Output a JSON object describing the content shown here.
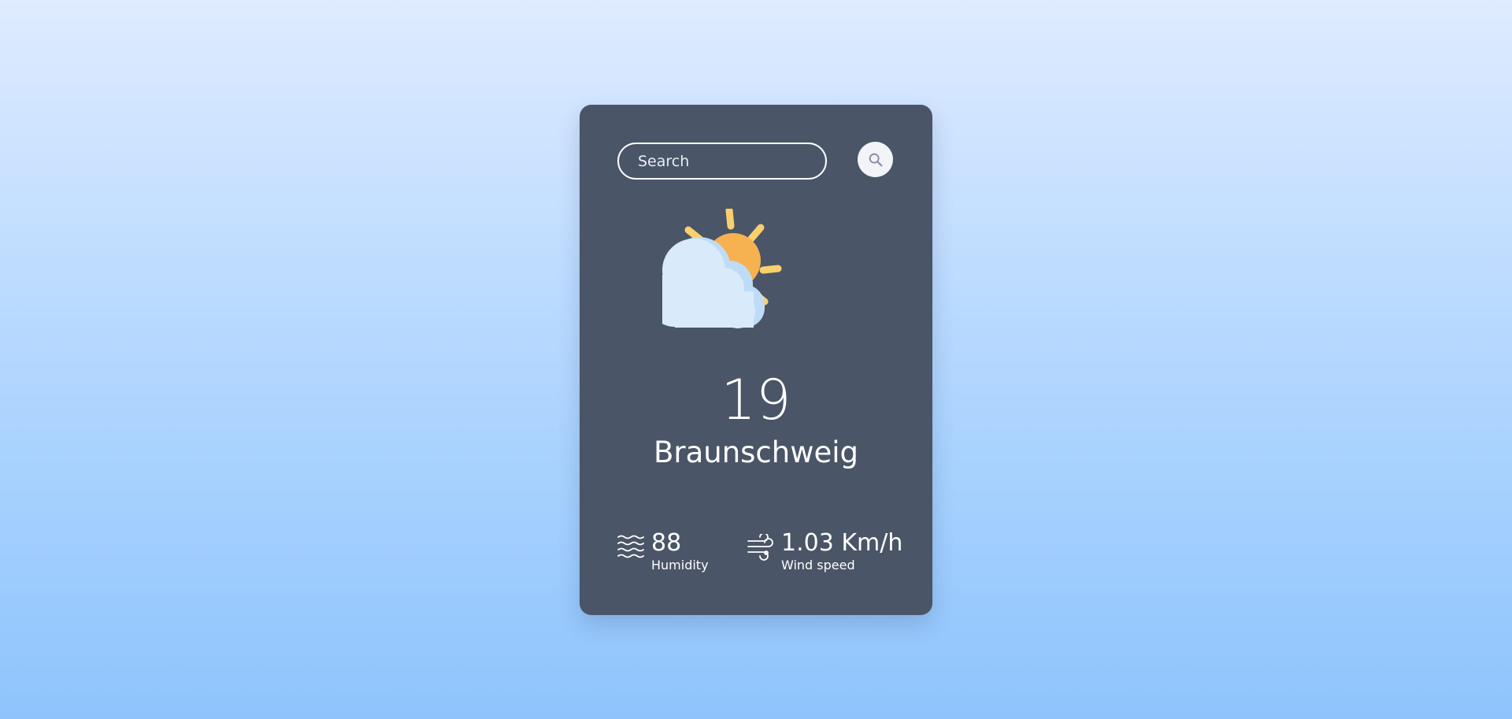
{
  "search": {
    "placeholder": "Search",
    "button_icon": "search-icon"
  },
  "weather": {
    "icon": "partly-cloudy-icon",
    "temperature": "19",
    "city": "Braunschweig"
  },
  "stats": {
    "humidity": {
      "icon": "humidity-icon",
      "value": "88",
      "label": "Humidity"
    },
    "wind": {
      "icon": "wind-icon",
      "value": "1.03 Km/h",
      "label": "Wind speed"
    }
  },
  "colors": {
    "card_background": "#4a5567",
    "sun": "#f6b150",
    "sun_rays": "#f9d06c",
    "cloud_light": "#d9ebfb",
    "cloud_shadow": "#bfdcf7",
    "page_gradient_top": "#dfebff",
    "page_gradient_bottom": "#8ec4fc"
  }
}
